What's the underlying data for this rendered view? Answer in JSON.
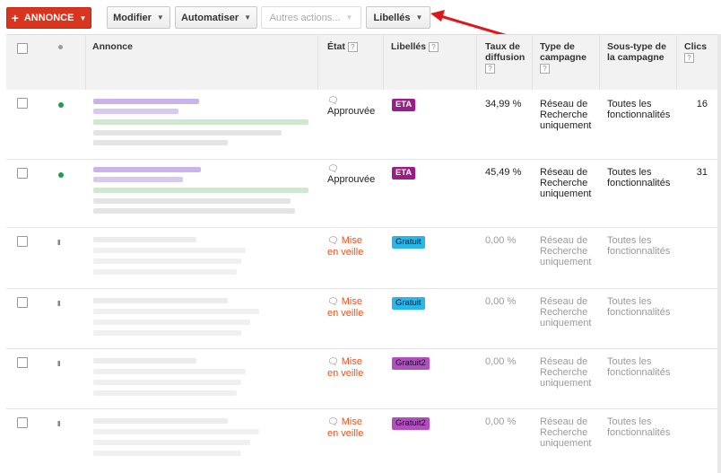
{
  "toolbar": {
    "add_ad": "ANNONCE",
    "modify": "Modifier",
    "automate": "Automatiser",
    "other_actions": "Autres actions...",
    "labels": "Libellés"
  },
  "table": {
    "headers": {
      "ad": "Annonce",
      "status": "État",
      "labels": "Libellés",
      "served_rate": "Taux de diffusion",
      "campaign_type": "Type de campagne",
      "campaign_subtype": "Sous-type de la campagne",
      "clicks": "Clics",
      "help": "?"
    },
    "rows": [
      {
        "status_line1": "Approuvée",
        "status_line2": "",
        "label": "ETA",
        "label_color": "#9c1c8a",
        "served_rate": "34,99 %",
        "campaign_type": [
          "Réseau de",
          "Recherche",
          "uniquement"
        ],
        "campaign_subtype": [
          "Toutes les",
          "fonctionnalités"
        ],
        "clicks": "16",
        "active": true
      },
      {
        "status_line1": "Approuvée",
        "status_line2": "",
        "label": "ETA",
        "label_color": "#9c1c8a",
        "served_rate": "45,49 %",
        "campaign_type": [
          "Réseau de",
          "Recherche",
          "uniquement"
        ],
        "campaign_subtype": [
          "Toutes les",
          "fonctionnalités"
        ],
        "clicks": "31",
        "active": true
      },
      {
        "status_line1": "Mise",
        "status_line2": "en veille",
        "label": "Gratuit",
        "label_color": "#29b6e8",
        "served_rate": "0,00 %",
        "campaign_type": [
          "Réseau de",
          "Recherche",
          "uniquement"
        ],
        "campaign_subtype": [
          "Toutes les",
          "fonctionnalités"
        ],
        "clicks": "",
        "active": false
      },
      {
        "status_line1": "Mise",
        "status_line2": "en veille",
        "label": "Gratuit",
        "label_color": "#29b6e8",
        "served_rate": "0,00 %",
        "campaign_type": [
          "Réseau de",
          "Recherche",
          "uniquement"
        ],
        "campaign_subtype": [
          "Toutes les",
          "fonctionnalités"
        ],
        "clicks": "",
        "active": false
      },
      {
        "status_line1": "Mise",
        "status_line2": "en veille",
        "label": "Gratuit2",
        "label_color": "#b24fbf",
        "served_rate": "0,00 %",
        "campaign_type": [
          "Réseau de",
          "Recherche",
          "uniquement"
        ],
        "campaign_subtype": [
          "Toutes les",
          "fonctionnalités"
        ],
        "clicks": "",
        "active": false
      },
      {
        "status_line1": "Mise",
        "status_line2": "en veille",
        "label": "Gratuit2",
        "label_color": "#b24fbf",
        "served_rate": "0,00 %",
        "campaign_type": [
          "Réseau de",
          "Recherche",
          "uniquement"
        ],
        "campaign_subtype": [
          "Toutes les",
          "fonctionnalités"
        ],
        "clicks": "",
        "active": false
      }
    ]
  },
  "colors": {
    "add_button": "#d9341e",
    "active_dot": "#1e9e48",
    "paused_text": "#e8551e",
    "arrow": "#e0161b"
  },
  "icons": {
    "plus": "plus-icon",
    "caret": "caret-down-icon",
    "status": "speech-bubble-icon",
    "paused": "pause-icon",
    "active": "green-dot-icon"
  }
}
